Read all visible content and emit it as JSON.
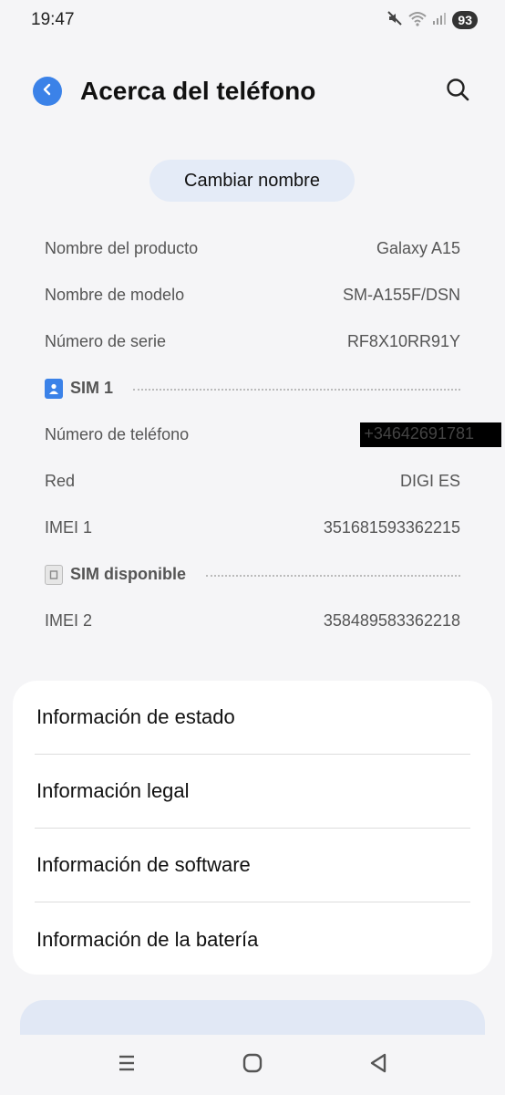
{
  "status_bar": {
    "time": "19:47",
    "battery": "93",
    "icons": [
      "mute-icon",
      "wifi-icon",
      "signal-icon",
      "battery-icon"
    ]
  },
  "header": {
    "title": "Acerca del teléfono",
    "back_icon": "back-icon",
    "search_icon": "search-icon"
  },
  "rename_button": "Cambiar nombre",
  "device_info": {
    "product_name": {
      "label": "Nombre del producto",
      "value": "Galaxy A15"
    },
    "model_name": {
      "label": "Nombre de modelo",
      "value": "SM-A155F/DSN"
    },
    "serial": {
      "label": "Número de serie",
      "value": "RF8X10RR91Y"
    }
  },
  "sim1": {
    "label": "SIM 1",
    "phone": {
      "label": "Número de teléfono",
      "value": "+34642691781"
    },
    "network": {
      "label": "Red",
      "value": "DIGI ES"
    },
    "imei": {
      "label": "IMEI 1",
      "value": "351681593362215"
    }
  },
  "sim2": {
    "label": "SIM disponible",
    "imei": {
      "label": "IMEI 2",
      "value": "358489583362218"
    }
  },
  "menu": [
    "Información de estado",
    "Información legal",
    "Información de software",
    "Información de la batería"
  ],
  "colors": {
    "accent": "#3b82e8",
    "background": "#f5f5f7",
    "button_bg": "#e4ebf7"
  }
}
